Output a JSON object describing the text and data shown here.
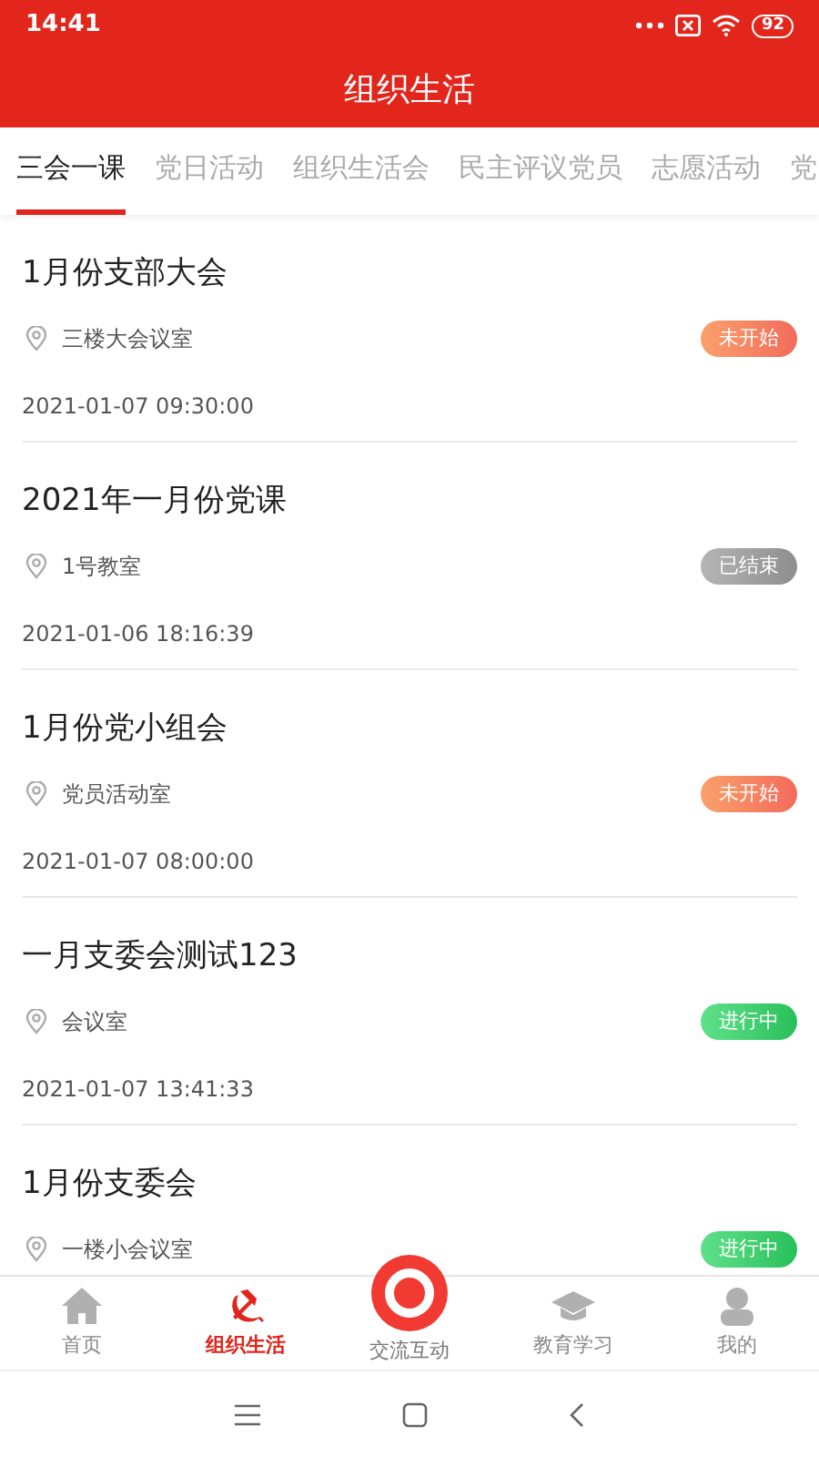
{
  "status_bar": {
    "time": "14:41",
    "battery": "92"
  },
  "header": {
    "title": "组织生活"
  },
  "tabs": [
    {
      "label": "三会一课",
      "selected": true
    },
    {
      "label": "党日活动",
      "selected": false
    },
    {
      "label": "组织生活会",
      "selected": false
    },
    {
      "label": "民主评议党员",
      "selected": false
    },
    {
      "label": "志愿活动",
      "selected": false
    },
    {
      "label": "党",
      "selected": false
    }
  ],
  "meetings": [
    {
      "title": "1月份支部大会",
      "location": "三楼大会议室",
      "status": "未开始",
      "kind": "upcoming",
      "time": "2021-01-07 09:30:00"
    },
    {
      "title": "2021年一月份党课",
      "location": "1号教室",
      "status": "已结束",
      "kind": "ended",
      "time": "2021-01-06 18:16:39"
    },
    {
      "title": "1月份党小组会",
      "location": "党员活动室",
      "status": "未开始",
      "kind": "upcoming",
      "time": "2021-01-07 08:00:00"
    },
    {
      "title": "一月支委会测试123",
      "location": "会议室",
      "status": "进行中",
      "kind": "ongoing",
      "time": "2021-01-07 13:41:33"
    },
    {
      "title": "1月份支委会",
      "location": "一楼小会议室",
      "status": "进行中",
      "kind": "ongoing"
    }
  ],
  "bottom_nav": [
    {
      "label": "首页",
      "kind": "home",
      "selected": false
    },
    {
      "label": "组织生活",
      "kind": "party",
      "selected": true
    },
    {
      "label": "交流互动",
      "kind": "center",
      "selected": false
    },
    {
      "label": "教育学习",
      "kind": "education",
      "selected": false
    },
    {
      "label": "我的",
      "kind": "profile",
      "selected": false
    }
  ]
}
